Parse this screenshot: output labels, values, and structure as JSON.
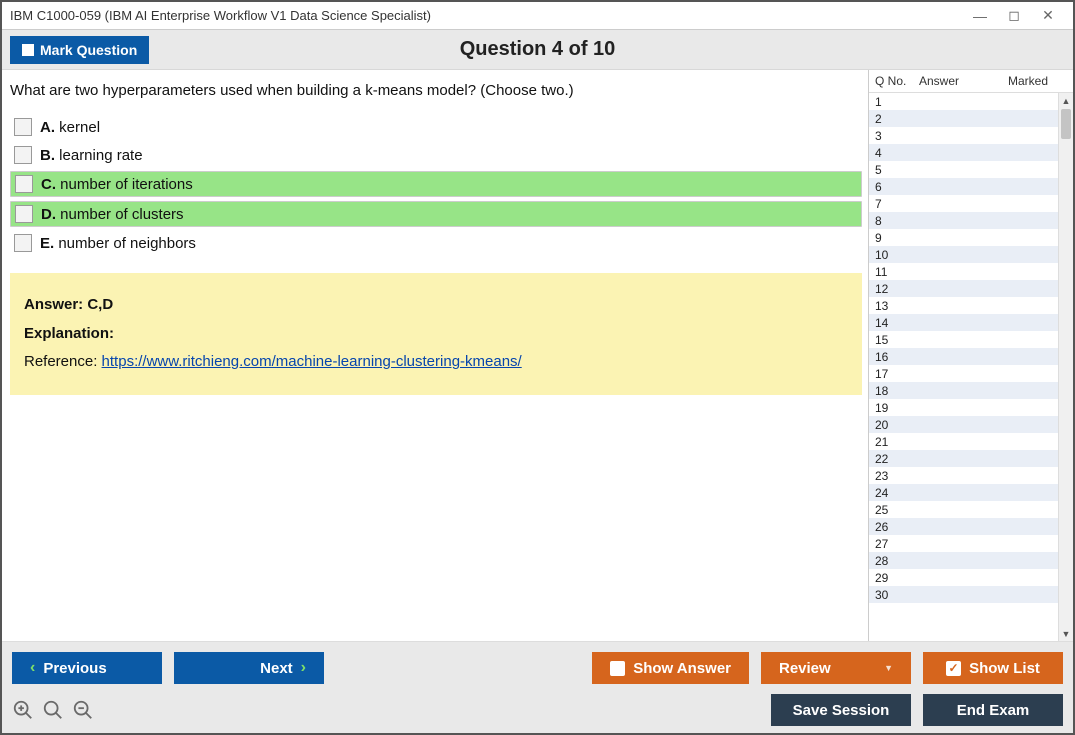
{
  "window": {
    "title": "IBM C1000-059 (IBM AI Enterprise Workflow V1 Data Science Specialist)"
  },
  "toolbar": {
    "mark_label": "Mark Question",
    "question_header": "Question 4 of 10"
  },
  "question": {
    "text": "What are two hyperparameters used when building a k-means model? (Choose two.)",
    "options": [
      {
        "letter": "A.",
        "text": "kernel",
        "highlight": false
      },
      {
        "letter": "B.",
        "text": "learning rate",
        "highlight": false
      },
      {
        "letter": "C.",
        "text": "number of iterations",
        "highlight": true
      },
      {
        "letter": "D.",
        "text": "number of clusters",
        "highlight": true
      },
      {
        "letter": "E.",
        "text": "number of neighbors",
        "highlight": false
      }
    ]
  },
  "answer_panel": {
    "answer_label": "Answer: C,D",
    "explanation_label": "Explanation:",
    "reference_prefix": "Reference: ",
    "reference_url": "https://www.ritchieng.com/machine-learning-clustering-kmeans/"
  },
  "sidebar": {
    "header": {
      "qno": "Q No.",
      "answer": "Answer",
      "marked": "Marked"
    },
    "row_count": 30
  },
  "footer": {
    "previous": "Previous",
    "next": "Next",
    "show_answer": "Show Answer",
    "review": "Review",
    "show_list": "Show List",
    "save_session": "Save Session",
    "end_exam": "End Exam"
  }
}
